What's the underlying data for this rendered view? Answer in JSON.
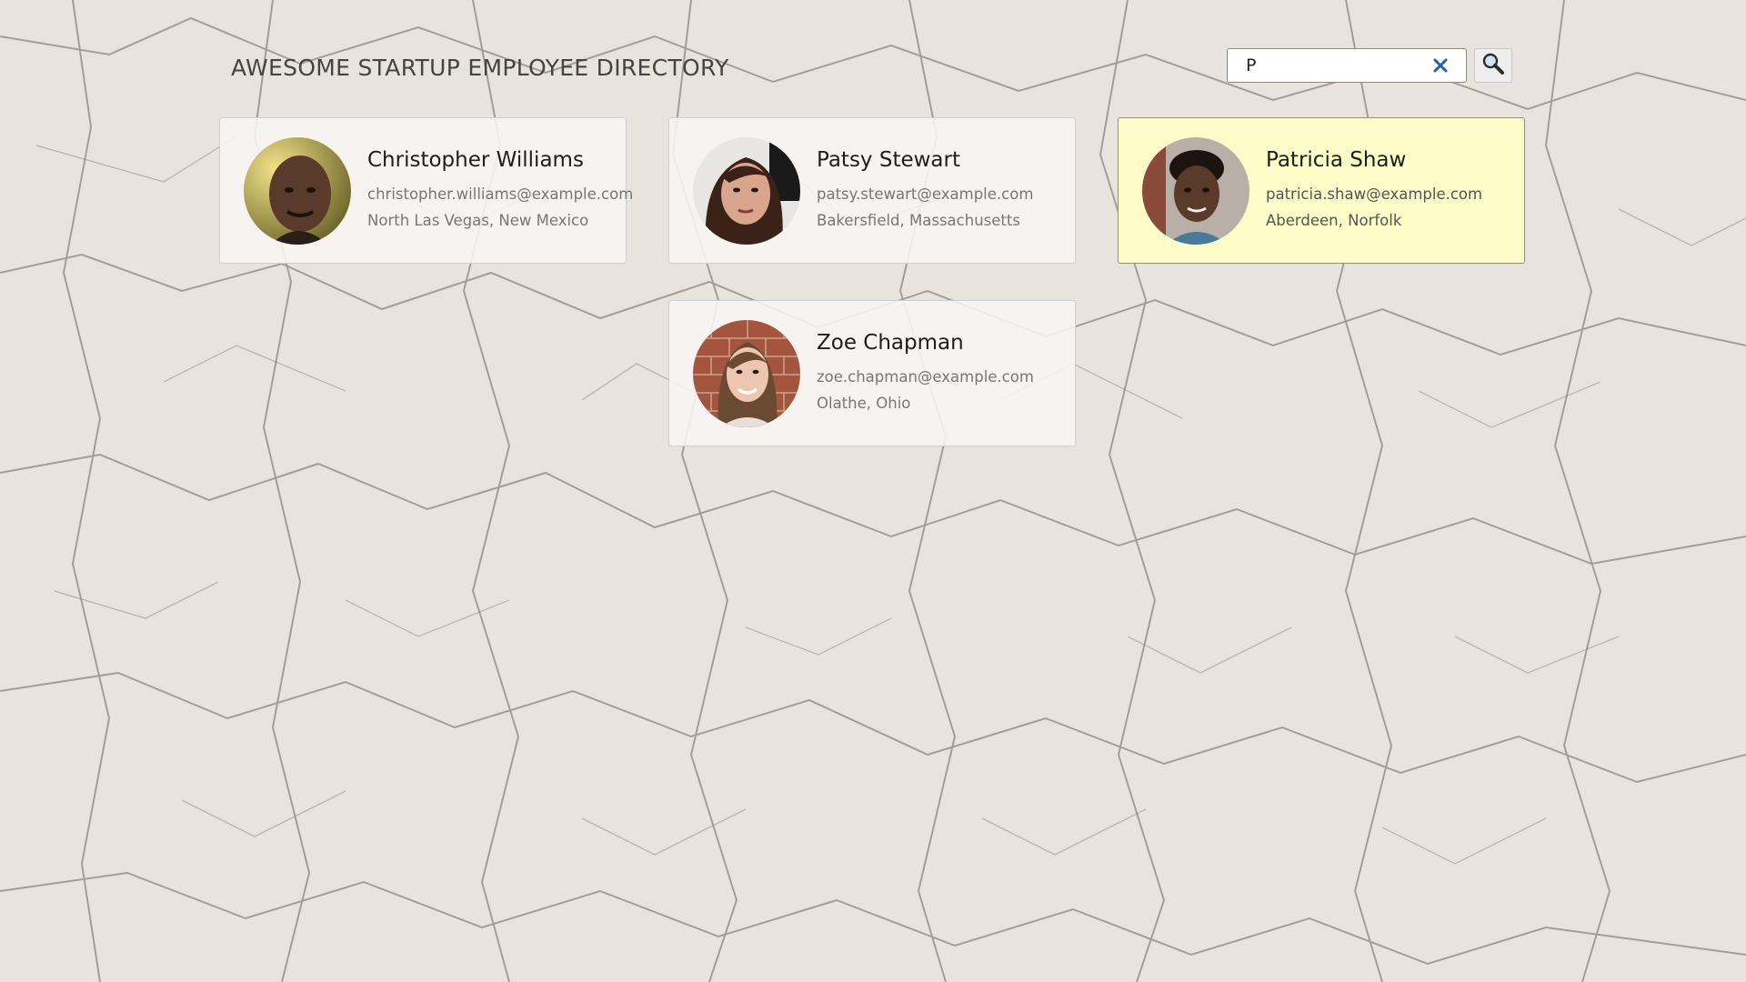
{
  "header": {
    "title": "AWESOME STARTUP EMPLOYEE DIRECTORY"
  },
  "search": {
    "value": "P",
    "clear_icon": "close-icon",
    "button_icon": "search-icon"
  },
  "employees": [
    {
      "name": "Christopher Williams",
      "email": "christopher.williams@example.com",
      "location": "North Las Vegas, New Mexico",
      "highlighted": false
    },
    {
      "name": "Patsy Stewart",
      "email": "patsy.stewart@example.com",
      "location": "Bakersfield, Massachusetts",
      "highlighted": false
    },
    {
      "name": "Patricia Shaw",
      "email": "patricia.shaw@example.com",
      "location": "Aberdeen, Norfolk",
      "highlighted": true
    },
    {
      "name": "Zoe Chapman",
      "email": "zoe.chapman@example.com",
      "location": "Olathe, Ohio",
      "highlighted": false
    }
  ],
  "colors": {
    "highlight": "#fdfcc8",
    "clear_icon": "#1f5fa8",
    "background": "#e9e4de"
  }
}
